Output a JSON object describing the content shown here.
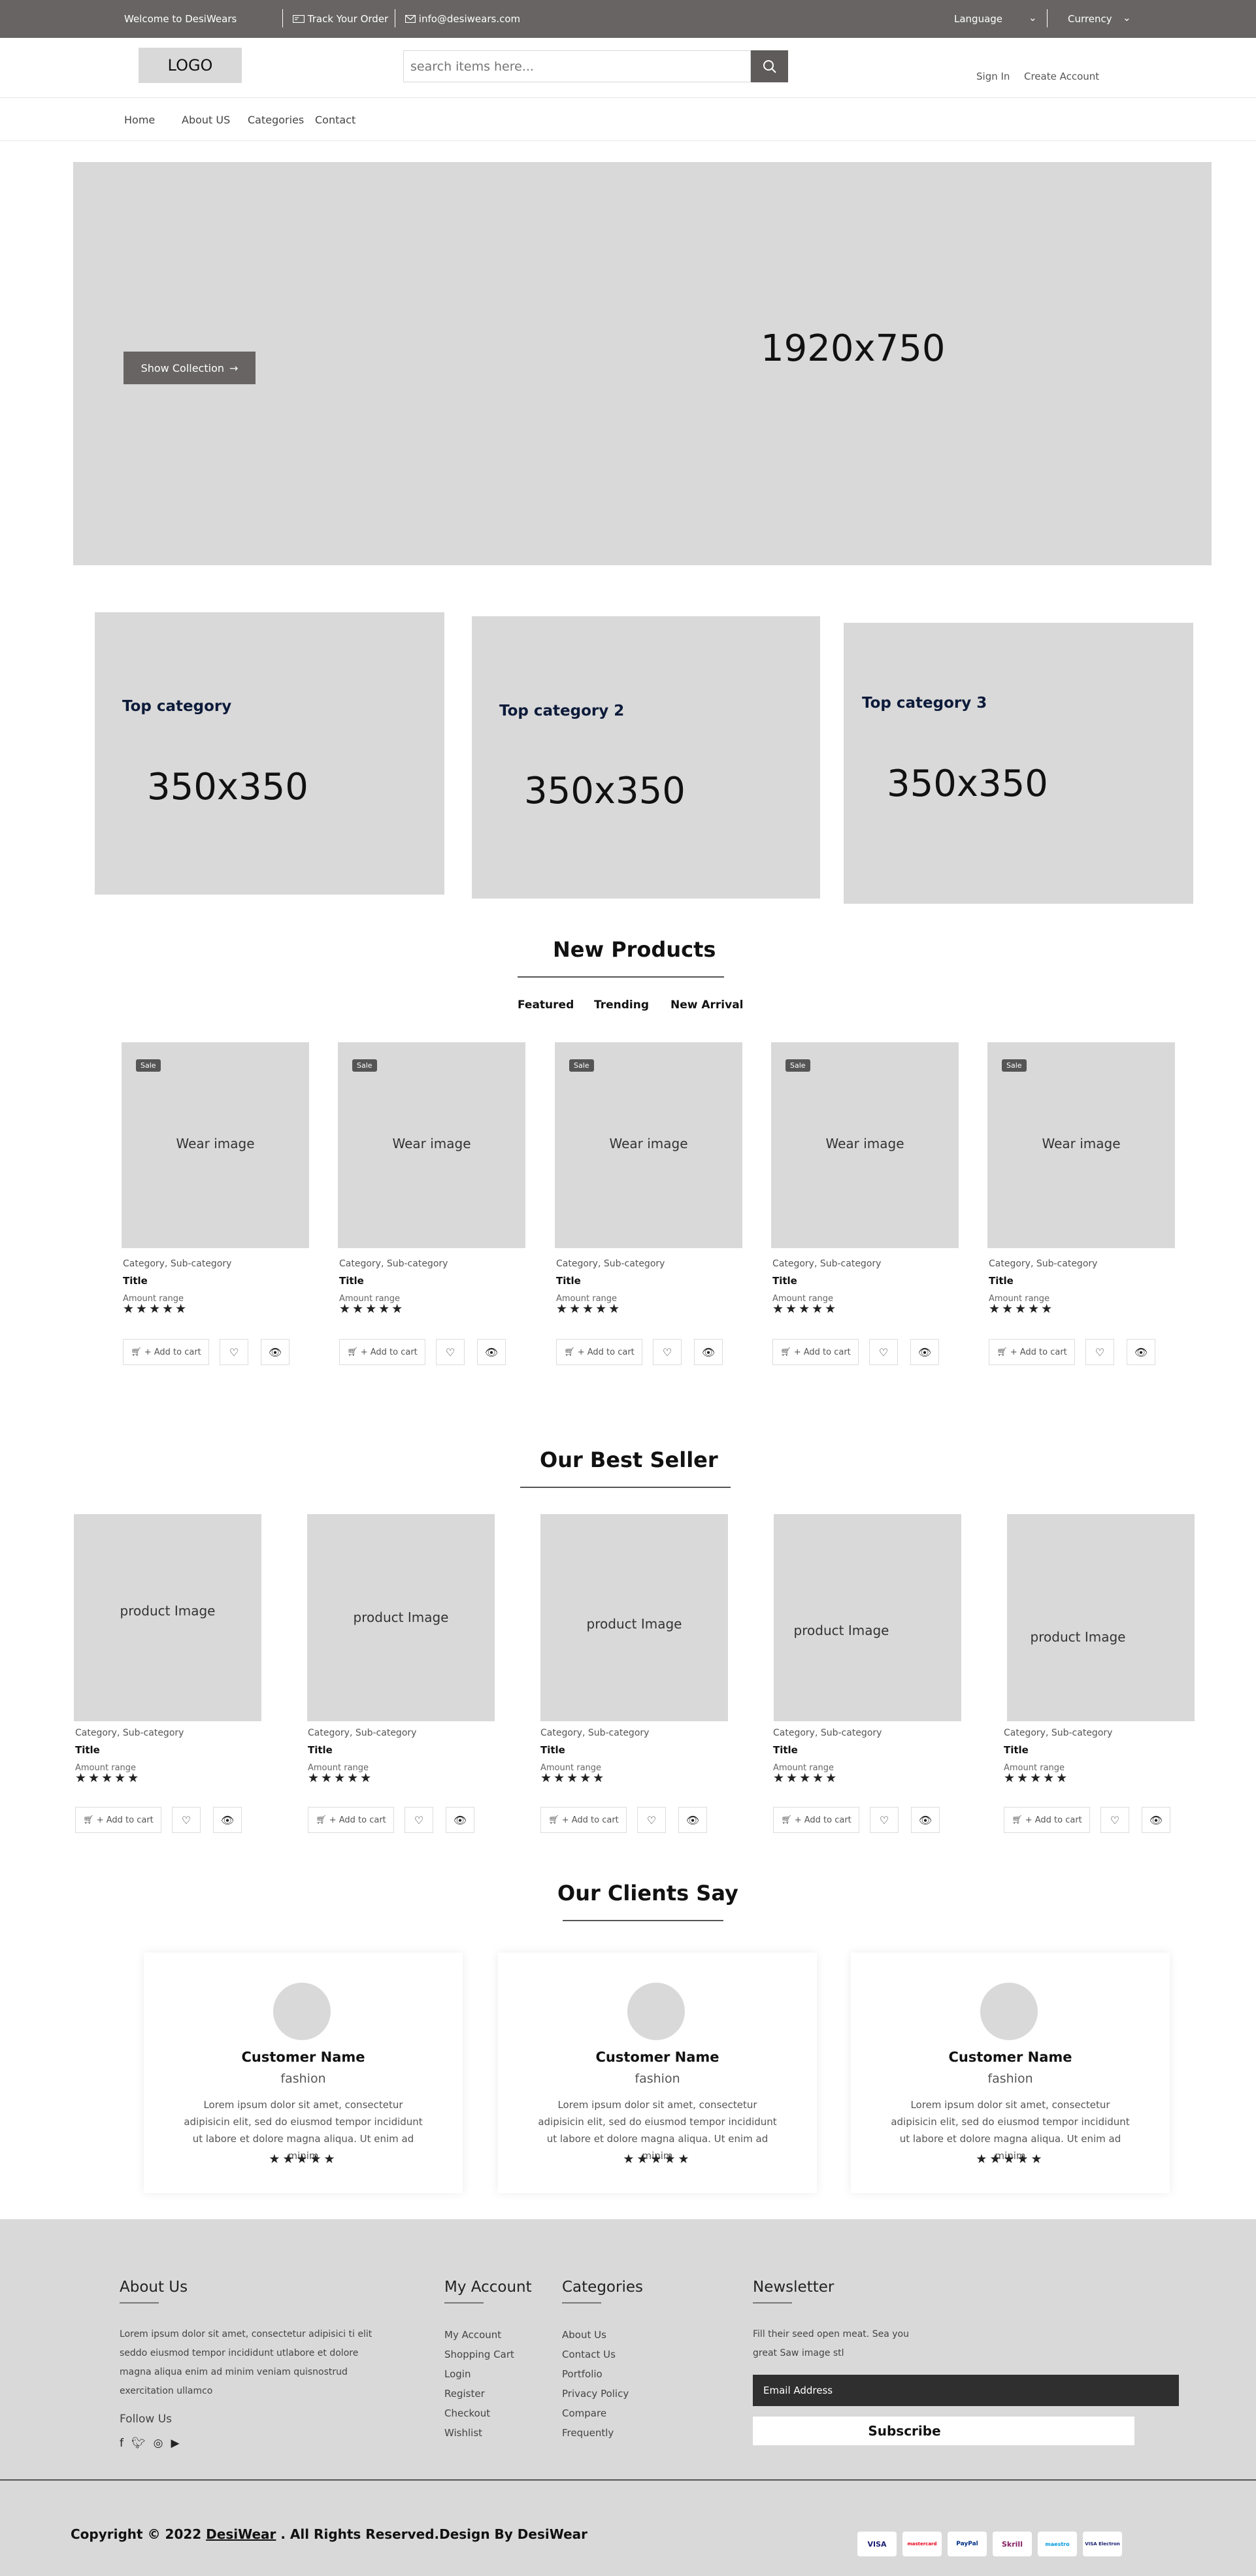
{
  "topbar": {
    "welcome": "Welcome to DesiWears",
    "track": "Track Your Order",
    "email": "info@desiwears.com",
    "language": "Language",
    "currency": "Currency"
  },
  "header": {
    "logo": "LOGO",
    "search_placeholder": "search items here...",
    "sign_in": "Sign In",
    "create_account": "Create Account"
  },
  "nav": [
    "Home",
    "About US",
    "Categories",
    "Contact"
  ],
  "hero": {
    "button": "Show Collection",
    "size_label": "1920x750"
  },
  "categories": [
    {
      "title": "Top category",
      "size": "350x350"
    },
    {
      "title": "Top category 2",
      "size": "350x350"
    },
    {
      "title": "Top category 3",
      "size": "350x350"
    }
  ],
  "new_products": {
    "title": "New Products",
    "tabs": [
      "Featured",
      "Trending",
      "New Arrival"
    ],
    "items": [
      {
        "badge": "Sale",
        "image": "Wear image",
        "category": "Category, Sub-category",
        "title": "Title",
        "amount": "Amount range",
        "rating": 5
      },
      {
        "badge": "Sale",
        "image": "Wear image",
        "category": "Category, Sub-category",
        "title": "Title",
        "amount": "Amount range",
        "rating": 5
      },
      {
        "badge": "Sale",
        "image": "Wear image",
        "category": "Category, Sub-category",
        "title": "Title",
        "amount": "Amount range",
        "rating": 5
      },
      {
        "badge": "Sale",
        "image": "Wear image",
        "category": "Category, Sub-category",
        "title": "Title",
        "amount": "Amount range",
        "rating": 5
      },
      {
        "badge": "Sale",
        "image": "Wear image",
        "category": "Category, Sub-category",
        "title": "Title",
        "amount": "Amount range",
        "rating": 5
      }
    ]
  },
  "best_seller": {
    "title": "Our Best Seller",
    "items": [
      {
        "image": "product Image",
        "category": "Category, Sub-category",
        "title": "Title",
        "amount": "Amount range",
        "rating": 5
      },
      {
        "image": "product Image",
        "category": "Category, Sub-category",
        "title": "Title",
        "amount": "Amount range",
        "rating": 5
      },
      {
        "image": "product Image",
        "category": "Category, Sub-category",
        "title": "Title",
        "amount": "Amount range",
        "rating": 5
      },
      {
        "image": "product Image",
        "category": "Category, Sub-category",
        "title": "Title",
        "amount": "Amount range",
        "rating": 5
      },
      {
        "image": "product Image",
        "category": "Category, Sub-category",
        "title": "Title",
        "amount": "Amount range",
        "rating": 5
      }
    ]
  },
  "add_to_cart": "+ Add to cart",
  "stars": "★★★★★",
  "clients": {
    "title": "Our Clients Say",
    "cards": [
      {
        "name": "Customer Name",
        "role": "fashion",
        "text": "Lorem ipsum dolor sit amet, consectetur adipisicin elit, sed do eiusmod tempor incididunt ut labore et dolore magna aliqua. Ut enim ad minim",
        "rating": 5
      },
      {
        "name": "Customer Name",
        "role": "fashion",
        "text": "Lorem ipsum dolor sit amet, consectetur adipisicin elit, sed do eiusmod tempor incididunt ut labore et dolore magna aliqua. Ut enim ad minim",
        "rating": 5
      },
      {
        "name": "Customer Name",
        "role": "fashion",
        "text": "Lorem ipsum dolor sit amet, consectetur adipisicin elit, sed do eiusmod tempor incididunt ut labore et dolore magna aliqua. Ut enim ad minim",
        "rating": 5
      }
    ]
  },
  "footer": {
    "about_title": "About Us",
    "about_text": "Lorem ipsum dolor sit amet, consectetur adipisici ti elit seddo eiusmod tempor incididunt utlabore et dolore magna aliqua enim ad minim veniam quisnostrud exercitation ullamco",
    "follow": "Follow Us",
    "account_title": "My Account",
    "account_links": [
      "My Account",
      "Shopping Cart",
      "Login",
      "Register",
      "Checkout",
      "Wishlist"
    ],
    "categories_title": "Categories",
    "categories_links": [
      "About Us",
      "Contact Us",
      "Portfolio",
      "Privacy Policy",
      "Compare",
      "Frequently"
    ],
    "newsletter_title": "Newsletter",
    "newsletter_text": "Fill their seed open meat. Sea you great Saw image stl",
    "email_placeholder": "Email Address",
    "subscribe": "Subscribe",
    "copyright_prefix": "Copyright © 2022",
    "brand": "DesiWear",
    "copyright_suffix": ". All Rights Reserved.Design By DesiWear",
    "payments": [
      "VISA",
      "mastercard",
      "PayPal",
      "Skrill",
      "maestro",
      "VISA Electron"
    ]
  }
}
